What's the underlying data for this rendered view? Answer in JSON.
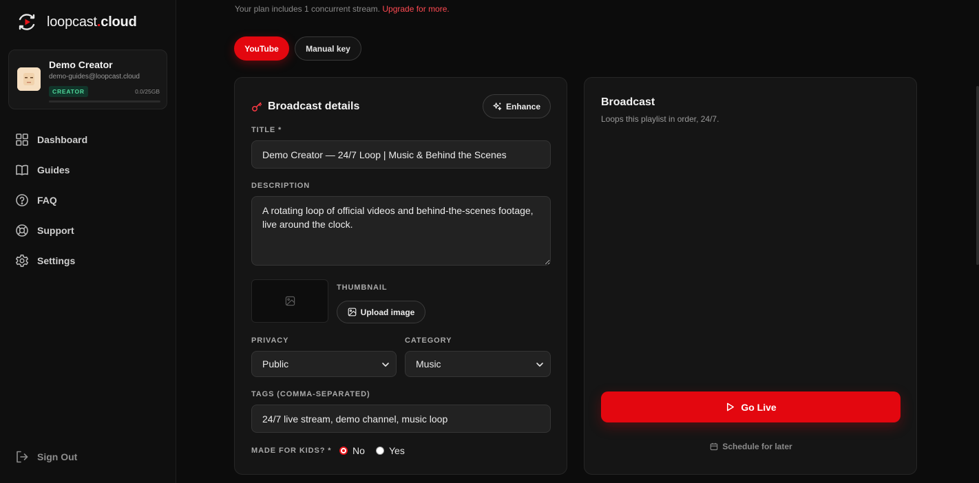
{
  "brand": {
    "name_regular": "loopcast",
    "name_dot": ".",
    "name_bold": "cloud"
  },
  "profile": {
    "name": "Demo Creator",
    "email": "demo-guides@loopcast.cloud",
    "tier": "CREATOR",
    "storage": "0.0/25GB",
    "storage_used_fraction": 0.0
  },
  "nav": {
    "items": [
      {
        "label": "Dashboard",
        "icon": "grid-icon"
      },
      {
        "label": "Guides",
        "icon": "book-icon"
      },
      {
        "label": "FAQ",
        "icon": "help-circle-icon"
      },
      {
        "label": "Support",
        "icon": "lifebuoy-icon"
      },
      {
        "label": "Settings",
        "icon": "gear-icon"
      }
    ],
    "sign_out": "Sign Out"
  },
  "plan_note": {
    "text": "Your plan includes 1 concurrent stream.",
    "link": "Upgrade for more."
  },
  "tabs": [
    {
      "label": "YouTube",
      "active": true
    },
    {
      "label": "Manual key",
      "active": false
    }
  ],
  "details": {
    "heading": "Broadcast details",
    "enhance_label": "Enhance",
    "title_label": "TITLE *",
    "title_value": "Demo Creator — 24/7 Loop | Music & Behind the Scenes",
    "description_label": "DESCRIPTION",
    "description_value": "A rotating loop of official videos and behind-the-scenes footage, live around the clock.",
    "thumbnail_label": "THUMBNAIL",
    "upload_label": "Upload image",
    "privacy_label": "PRIVACY",
    "privacy_value": "Public",
    "category_label": "CATEGORY",
    "category_value": "Music",
    "tags_label": "TAGS (COMMA-SEPARATED)",
    "tags_value": "24/7 live stream, demo channel, music loop",
    "kids_label": "MADE FOR KIDS? *",
    "kids_options": [
      {
        "label": "No",
        "selected": true
      },
      {
        "label": "Yes",
        "selected": false
      }
    ]
  },
  "broadcast": {
    "title": "Broadcast",
    "subtitle": "Loops this playlist in order, 24/7.",
    "go_live": "Go Live",
    "schedule": "Schedule for later"
  },
  "colors": {
    "accent": "#e3070f",
    "creator_badge": "#4fd79a",
    "background": "#0c0c0c"
  }
}
